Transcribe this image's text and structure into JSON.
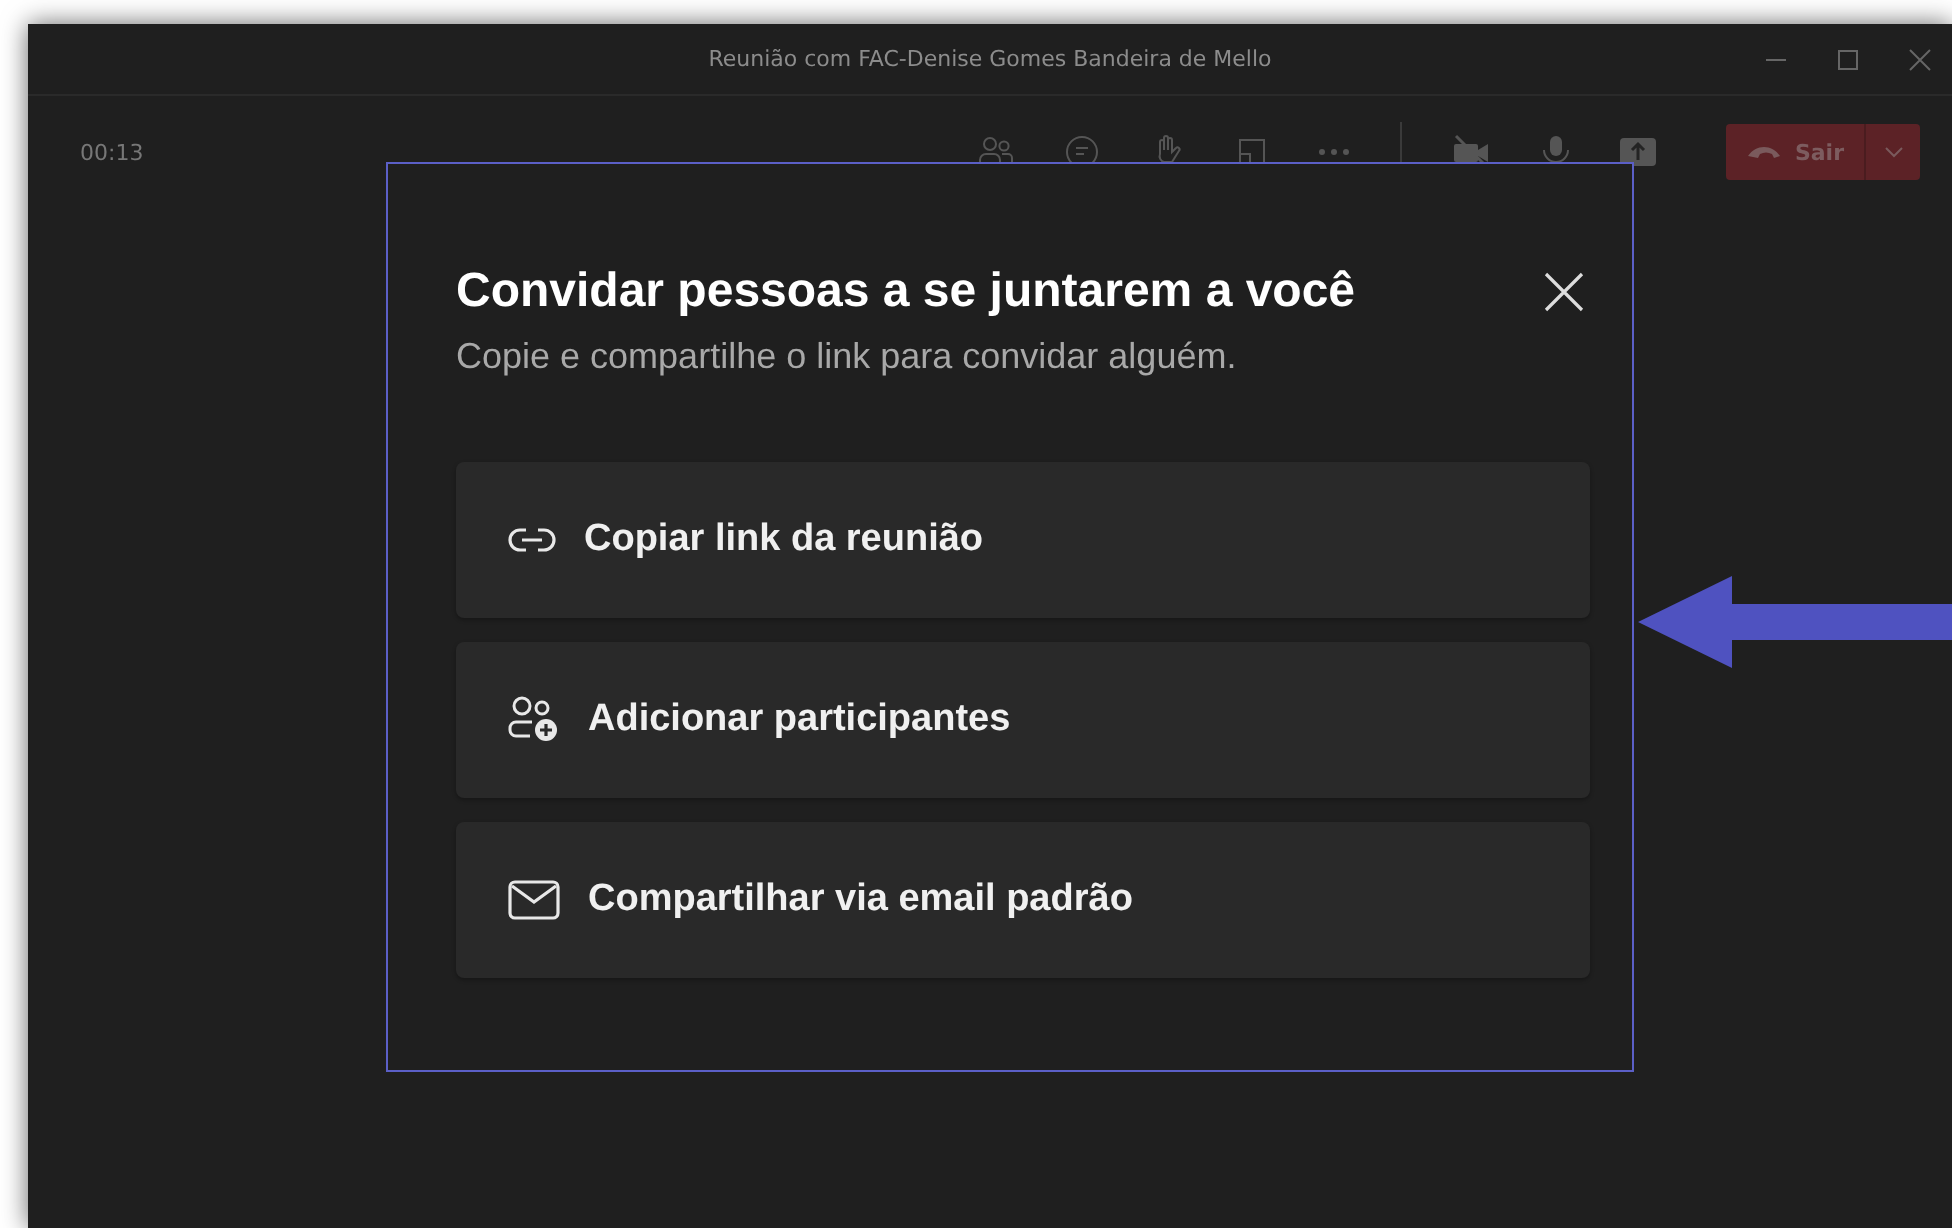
{
  "window": {
    "title": "Reunião com FAC-Denise Gomes Bandeira de Mello"
  },
  "toolbar": {
    "timer": "00:13",
    "leave_button": "Sair"
  },
  "dialog": {
    "title": "Convidar pessoas a se juntarem a você",
    "subtitle": "Copie e compartilhe o link para convidar alguém.",
    "options": [
      {
        "kind": "link",
        "label": "Copiar link da reunião"
      },
      {
        "kind": "people-add",
        "label": "Adicionar participantes"
      },
      {
        "kind": "mail",
        "label": "Compartilhar via email padrão"
      }
    ]
  }
}
